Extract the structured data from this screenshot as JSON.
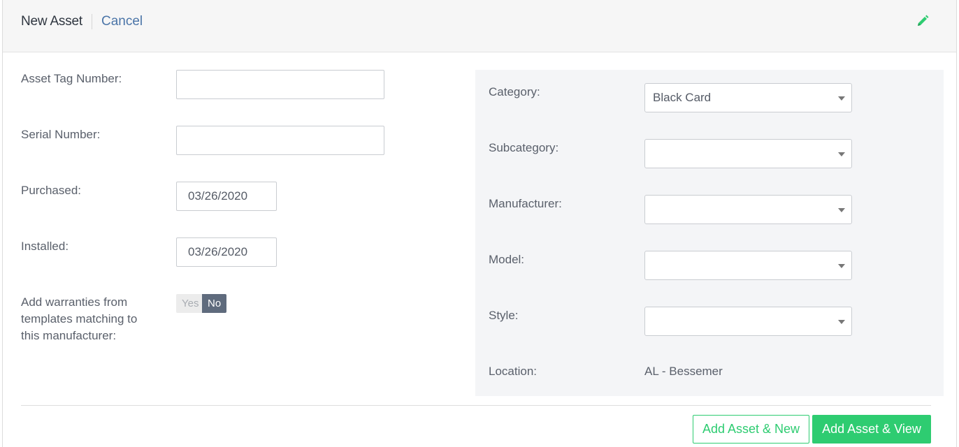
{
  "header": {
    "title": "New Asset",
    "cancel_label": "Cancel",
    "edit_icon": "pencil-icon",
    "edit_icon_color": "#2ecc71"
  },
  "form": {
    "asset_tag": {
      "label": "Asset Tag Number:",
      "value": ""
    },
    "serial": {
      "label": "Serial Number:",
      "value": ""
    },
    "purchased": {
      "label": "Purchased:",
      "value": "03/26/2020"
    },
    "installed": {
      "label": "Installed:",
      "value": "03/26/2020"
    },
    "warranty": {
      "label_line1": "Add warranties from",
      "label_line2": "templates matching to",
      "label_line3": "this manufacturer:",
      "yes_label": "Yes",
      "no_label": "No",
      "selected": "No"
    }
  },
  "panel": {
    "category": {
      "label": "Category:",
      "value": "Black Card"
    },
    "subcategory": {
      "label": "Subcategory:",
      "value": ""
    },
    "manufacturer": {
      "label": "Manufacturer:",
      "value": ""
    },
    "model": {
      "label": "Model:",
      "value": ""
    },
    "style": {
      "label": "Style:",
      "value": ""
    },
    "location": {
      "label": "Location:",
      "value": "AL - Bessemer"
    }
  },
  "actions": {
    "add_new_label": "Add Asset & New",
    "add_view_label": "Add Asset & View",
    "accent_color": "#2ecc71"
  }
}
